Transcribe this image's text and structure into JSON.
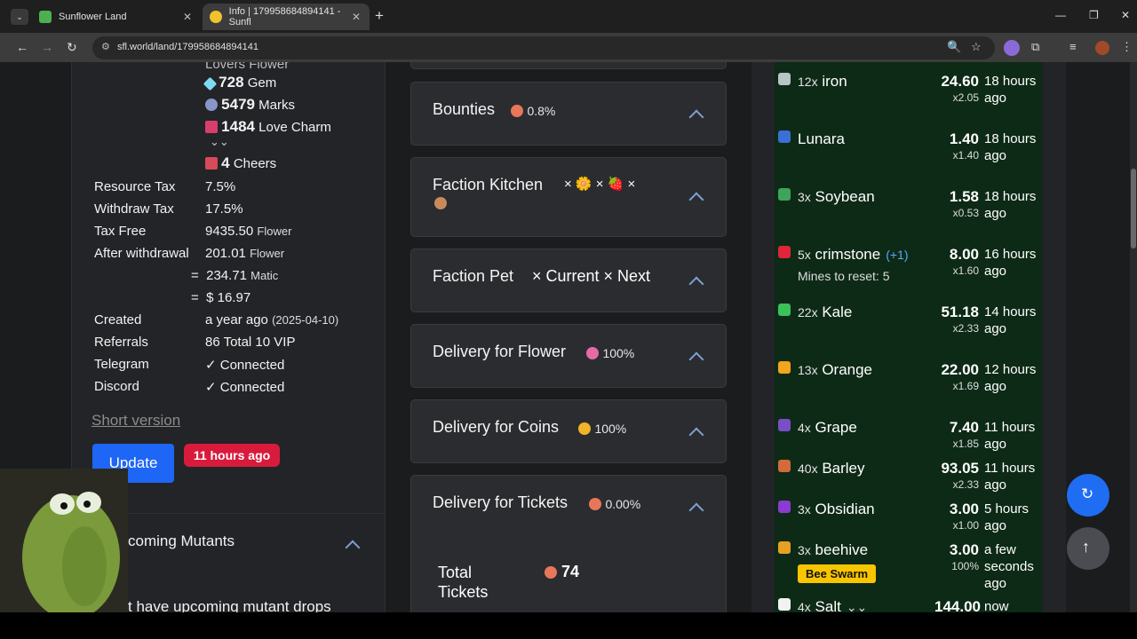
{
  "browser": {
    "tabs": [
      {
        "label": "Sunflower Land"
      },
      {
        "label": "Info | 179958684894141 - Sunfl"
      }
    ],
    "url": "sfl.world/land/179958684894141"
  },
  "left": {
    "partial_top": "Lovers Flower",
    "resources": [
      {
        "amount": "728",
        "label": "Gem"
      },
      {
        "amount": "5479",
        "label": "Marks"
      },
      {
        "amount": "1484",
        "label": "Love Charm"
      },
      {
        "amount": "4",
        "label": "Cheers"
      }
    ],
    "expand_glyph": "⌄⌄",
    "rows": [
      {
        "label": "Resource Tax",
        "value": "7.5%",
        "unit": ""
      },
      {
        "label": "Withdraw Tax",
        "value": "17.5%",
        "unit": ""
      },
      {
        "label": "Tax Free",
        "value": "9435.50",
        "unit": "Flower"
      },
      {
        "label": "After withdrawal",
        "value": "201.01",
        "unit": "Flower"
      }
    ],
    "eq_matic": {
      "prefix": "=",
      "value": "234.71",
      "unit": "Matic"
    },
    "eq_usd": {
      "prefix": "=",
      "value": "$ 16.97"
    },
    "created": {
      "label": "Created",
      "value": "a year ago",
      "detail": "(2025-04-10)"
    },
    "referrals": {
      "label": "Referrals",
      "value": "86 Total 10 VIP"
    },
    "telegram": {
      "label": "Telegram",
      "value": "Connected"
    },
    "discord": {
      "label": "Discord",
      "value": "Connected"
    },
    "short_version": "Short version",
    "update_button": "Update",
    "updated_badge": "11 hours ago",
    "mutants_title": "coming Mutants",
    "mutants_text": "t have upcoming mutant drops"
  },
  "middle": {
    "cards": [
      {
        "title": "Bounties",
        "pct": "0.8%"
      },
      {
        "title": "Faction Kitchen",
        "extra": "× 🌼 × 🍓 ×"
      },
      {
        "title": "Faction Pet",
        "extra": "× Current × Next"
      },
      {
        "title": "Delivery for Flower",
        "pct": "100%"
      },
      {
        "title": "Delivery for Coins",
        "pct": "100%"
      },
      {
        "title": "Delivery for Tickets",
        "pct": "0.00%"
      }
    ],
    "total_tickets_label": "Total Tickets",
    "total_tickets_value": "74"
  },
  "right": {
    "items": [
      {
        "qty": "12x",
        "name": "iron",
        "value": "24.60",
        "mult": "x2.05",
        "time": "18 hours ago",
        "color": "#b9c4c9"
      },
      {
        "qty": "",
        "name": "Lunara",
        "value": "1.40",
        "mult": "x1.40",
        "time": "18 hours ago",
        "color": "#3b6fd6"
      },
      {
        "qty": "3x",
        "name": "Soybean",
        "value": "1.58",
        "mult": "x0.53",
        "time": "18 hours ago",
        "color": "#3fa45a"
      },
      {
        "qty": "5x",
        "name": "crimstone",
        "extra": "(+1)",
        "sub": "Mines to reset: 5",
        "value": "8.00",
        "mult": "x1.60",
        "time": "16 hours ago",
        "color": "#e0243b"
      },
      {
        "qty": "22x",
        "name": "Kale",
        "value": "51.18",
        "mult": "x2.33",
        "time": "14 hours ago",
        "color": "#3cc05a"
      },
      {
        "qty": "13x",
        "name": "Orange",
        "value": "22.00",
        "mult": "x1.69",
        "time": "12 hours ago",
        "color": "#f3a51d"
      },
      {
        "qty": "4x",
        "name": "Grape",
        "value": "7.40",
        "mult": "x1.85",
        "time": "11 hours ago",
        "color": "#7a4fc6"
      },
      {
        "qty": "40x",
        "name": "Barley",
        "value": "93.05",
        "mult": "x2.33",
        "time": "11 hours ago",
        "color": "#d36a3a"
      },
      {
        "qty": "3x",
        "name": "Obsidian",
        "value": "3.00",
        "mult": "x1.00",
        "time": "5 hours ago",
        "color": "#8a3bd0"
      },
      {
        "qty": "3x",
        "name": "beehive",
        "value": "3.00",
        "mult": "100%",
        "time": "a few seconds ago",
        "badge": "Bee Swarm",
        "color": "#e7a021"
      },
      {
        "qty": "4x",
        "name": "Salt",
        "extra": "⌄⌄",
        "value": "144.00",
        "mult": "",
        "time": "now",
        "color": "#f2f2f2"
      }
    ]
  }
}
